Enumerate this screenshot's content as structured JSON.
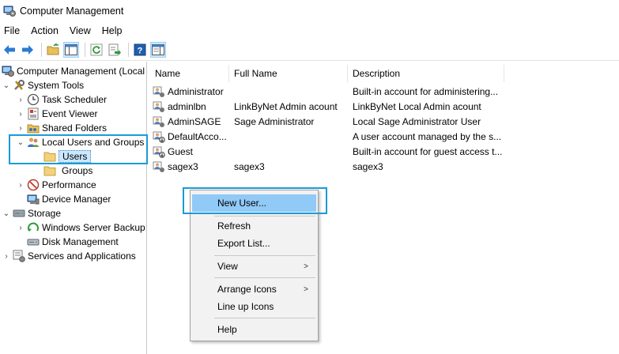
{
  "window": {
    "title": "Computer Management"
  },
  "menubar": [
    "File",
    "Action",
    "View",
    "Help"
  ],
  "tree": {
    "root": "Computer Management (Local",
    "system_tools": "System Tools",
    "task_scheduler": "Task Scheduler",
    "event_viewer": "Event Viewer",
    "shared_folders": "Shared Folders",
    "local_users_groups": "Local Users and Groups",
    "users": "Users",
    "groups": "Groups",
    "performance": "Performance",
    "device_manager": "Device Manager",
    "storage": "Storage",
    "windows_server_backup": "Windows Server Backup",
    "disk_management": "Disk Management",
    "services_apps": "Services and Applications"
  },
  "list": {
    "columns": [
      "Name",
      "Full Name",
      "Description"
    ],
    "rows": [
      {
        "name": "Administrator",
        "full_name": "",
        "description": "Built-in account for administering..."
      },
      {
        "name": "adminlbn",
        "full_name": "LinkByNet Admin acount",
        "description": "LinkByNet Local Admin acount"
      },
      {
        "name": "AdminSAGE",
        "full_name": "Sage Administrator",
        "description": "Local Sage Administrator User"
      },
      {
        "name": "DefaultAcco...",
        "full_name": "",
        "description": "A user account managed by the s..."
      },
      {
        "name": "Guest",
        "full_name": "",
        "description": "Built-in account for guest access t..."
      },
      {
        "name": "sagex3",
        "full_name": "sagex3",
        "description": "sagex3"
      }
    ]
  },
  "context_menu": {
    "new_user": "New User...",
    "refresh": "Refresh",
    "export_list": "Export List...",
    "view": "View",
    "arrange_icons": "Arrange Icons",
    "line_up_icons": "Line up Icons",
    "help": "Help"
  },
  "colors": {
    "highlight_border": "#1a9bd7",
    "menu_hot": "#91c9f7",
    "selection": "#cce8ff"
  }
}
